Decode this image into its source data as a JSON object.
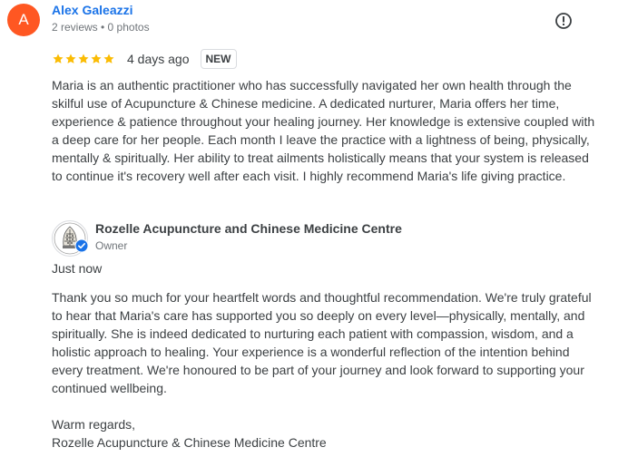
{
  "review": {
    "author": {
      "initial": "A",
      "name": "Alex Galeazzi",
      "meta": "2 reviews • 0 photos",
      "avatar_color": "#ff5722"
    },
    "rating": 5,
    "max_rating": 5,
    "star_color": "#fbbc04",
    "date": "4 days ago",
    "badge": "NEW",
    "report_icon": "report-icon",
    "text": "Maria is an authentic practitioner who has successfully navigated her own health through the skilful use of Acupuncture & Chinese medicine. A dedicated nurturer, Maria offers her time, experience & patience throughout your healing journey. Her knowledge is extensive coupled with a deep care for her people. Each month I leave the practice with a lightness of being, physically, mentally & spiritually. Her ability to treat ailments holistically means that your system is released to continue it's recovery well after each visit. I highly recommend Maria's life giving practice."
  },
  "owner_response": {
    "name": "Rozelle Acupuncture and Chinese Medicine Centre",
    "role": "Owner",
    "time": "Just now",
    "verified_color": "#1a73e8",
    "text": "Thank you so much for your heartfelt words and thoughtful recommendation. We're truly grateful to hear that Maria's care has supported you so deeply on every level—physically, mentally, and spiritually. She is indeed dedicated to nurturing each patient with compassion, wisdom, and a holistic approach to healing. Your experience is a wonderful reflection of the intention behind every treatment. We're honoured to be part of your journey and look forward to supporting your continued wellbeing.",
    "sign_off_greeting": "Warm regards,",
    "sign_off_name": "Rozelle Acupuncture & Chinese Medicine Centre"
  }
}
